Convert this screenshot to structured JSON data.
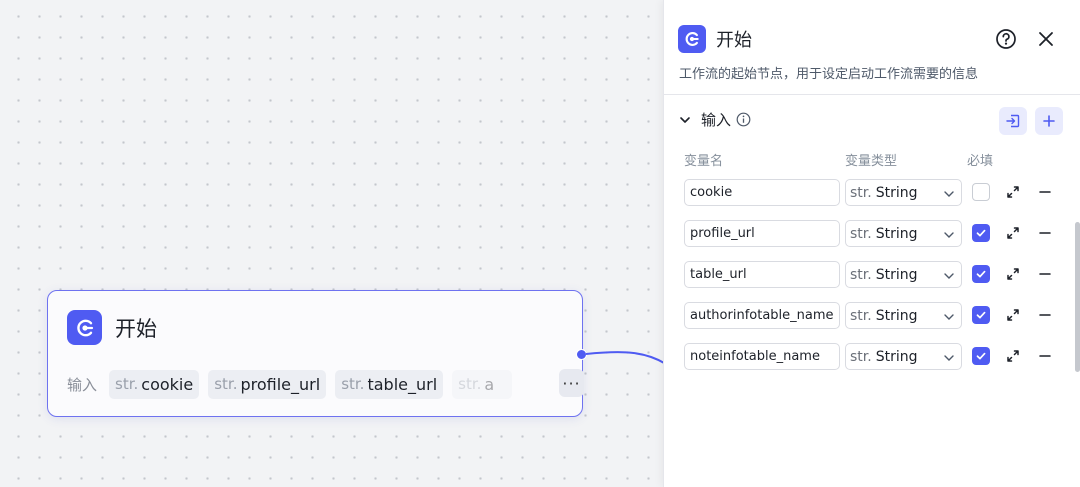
{
  "node": {
    "title": "开始",
    "inputs_label": "输入",
    "chips": [
      {
        "type": "str.",
        "name": "cookie"
      },
      {
        "type": "str.",
        "name": "profile_url"
      },
      {
        "type": "str.",
        "name": "table_url"
      },
      {
        "type": "str.",
        "name": "a"
      }
    ],
    "more_label": "···"
  },
  "panel": {
    "title": "开始",
    "description": "工作流的起始节点，用于设定启动工作流需要的信息",
    "section_title": "输入",
    "columns": {
      "name": "变量名",
      "type": "变量类型",
      "required": "必填"
    },
    "rows": [
      {
        "name": "cookie",
        "type_prefix": "str.",
        "type": "String",
        "required": false
      },
      {
        "name": "profile_url",
        "type_prefix": "str.",
        "type": "String",
        "required": true
      },
      {
        "name": "table_url",
        "type_prefix": "str.",
        "type": "String",
        "required": true
      },
      {
        "name": "authorinfotable_name",
        "type_prefix": "str.",
        "type": "String",
        "required": true
      },
      {
        "name": "noteinfotable_name",
        "type_prefix": "str.",
        "type": "String",
        "required": true
      }
    ]
  },
  "icons": {
    "node_icon": "start-node-icon",
    "help": "question-circle-icon",
    "close": "close-icon",
    "collapse": "chevron-down-icon",
    "info": "info-icon",
    "import": "import-icon",
    "add": "plus-icon",
    "expand": "expand-icon",
    "remove": "minus-icon"
  },
  "colors": {
    "accent": "#4f5bf2",
    "node_border": "#6e72f0"
  }
}
